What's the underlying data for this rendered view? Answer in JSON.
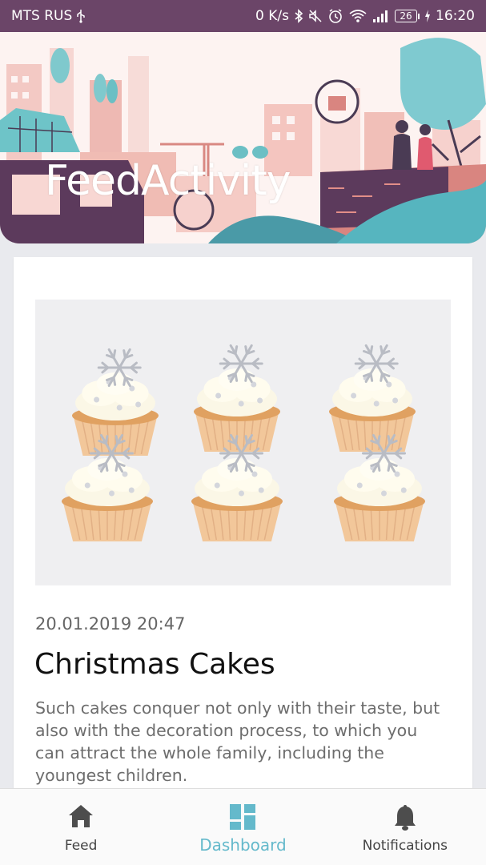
{
  "status_bar": {
    "carrier": "MTS RUS",
    "network_speed": "0 K/s",
    "battery_level": "26",
    "time": "16:20",
    "icons": [
      "usb-icon",
      "bluetooth-icon",
      "mute-icon",
      "alarm-icon",
      "wifi-icon",
      "signal-icon",
      "battery-icon",
      "charging-icon"
    ]
  },
  "header": {
    "title": "FeedActivity"
  },
  "feed": {
    "items": [
      {
        "date": "20.01.2019 20:47",
        "title": "Christmas Cakes",
        "description": "Such cakes conquer not only with their taste, but also with the decoration process, to which you can attract the whole family, including the youngest children."
      }
    ]
  },
  "bottom_nav": {
    "items": [
      {
        "label": "Feed",
        "icon": "home-icon",
        "active": false
      },
      {
        "label": "Dashboard",
        "icon": "dashboard-icon",
        "active": true
      },
      {
        "label": "Notifications",
        "icon": "bell-icon",
        "active": false
      }
    ]
  },
  "colors": {
    "status_bar_bg": "#6b4568",
    "accent": "#64b9cb",
    "page_bg": "#e9eaee",
    "card_bg": "#ffffff",
    "nav_inactive": "#444444"
  }
}
